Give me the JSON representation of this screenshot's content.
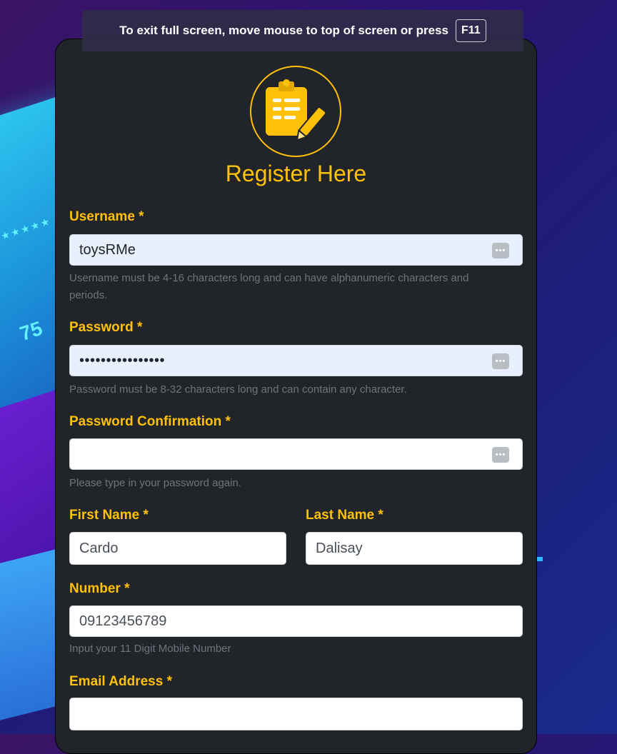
{
  "fullscreen_notice": {
    "text": "To exit full screen, move mouse to top of screen or press",
    "key": "F11"
  },
  "form": {
    "title": "Register Here",
    "logo_icon": "clipboard-pencil-icon",
    "accent_color": "#ffc107",
    "card_color": "#212529",
    "fields": {
      "username": {
        "label": "Username *",
        "value": "toysRMe",
        "help": "Username must be 4-16 characters long and can have alphanumeric characters and periods."
      },
      "password": {
        "label": "Password *",
        "value": "••••••••••••••••",
        "help": "Password must be 8-32 characters long and can contain any character."
      },
      "password_confirmation": {
        "label": "Password Confirmation *",
        "value": "",
        "help": "Please type in your password again."
      },
      "first_name": {
        "label": "First Name *",
        "value": "Cardo"
      },
      "last_name": {
        "label": "Last Name *",
        "value": "Dalisay"
      },
      "number": {
        "label": "Number *",
        "value": "09123456789",
        "help": "Input your 11 Digit Mobile Number"
      },
      "email": {
        "label": "Email Address *",
        "value": ""
      }
    }
  }
}
